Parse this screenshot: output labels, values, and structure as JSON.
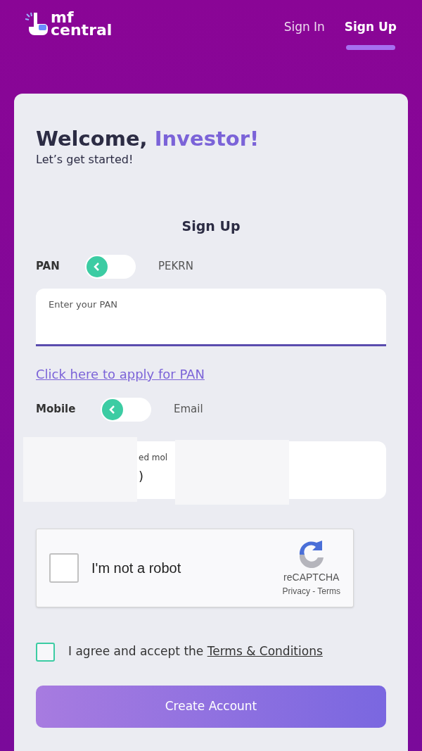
{
  "header": {
    "logo": {
      "line_1": "mf",
      "line_2": "central"
    },
    "nav": [
      {
        "label": "Sign In",
        "selected": false
      },
      {
        "label": "Sign Up",
        "selected": true
      }
    ]
  },
  "card": {
    "greeting": "Welcome,",
    "greeting_name": "Investor!",
    "subtitle": "Let’s get started!",
    "form_title": "Sign Up",
    "id_switch": {
      "left_label": "PAN",
      "right_label": "PEKRN",
      "on": false
    },
    "pan_field": {
      "placeholder": "Enter your PAN"
    },
    "apply_link": "Click here to apply for PAN",
    "contact_switch": {
      "left_label": "Mobile",
      "right_label": "Email",
      "on": false
    },
    "contact_field": {
      "label": "ed mol",
      "value": ")"
    },
    "captcha": {
      "label": "I'm not a robot",
      "checked": false,
      "brand": "reCAPTCHA",
      "links": "Privacy - Terms"
    },
    "agree": {
      "checked": false,
      "text": "I agree and accept the",
      "link": "Terms & Conditions"
    },
    "submit": "Create Account"
  }
}
